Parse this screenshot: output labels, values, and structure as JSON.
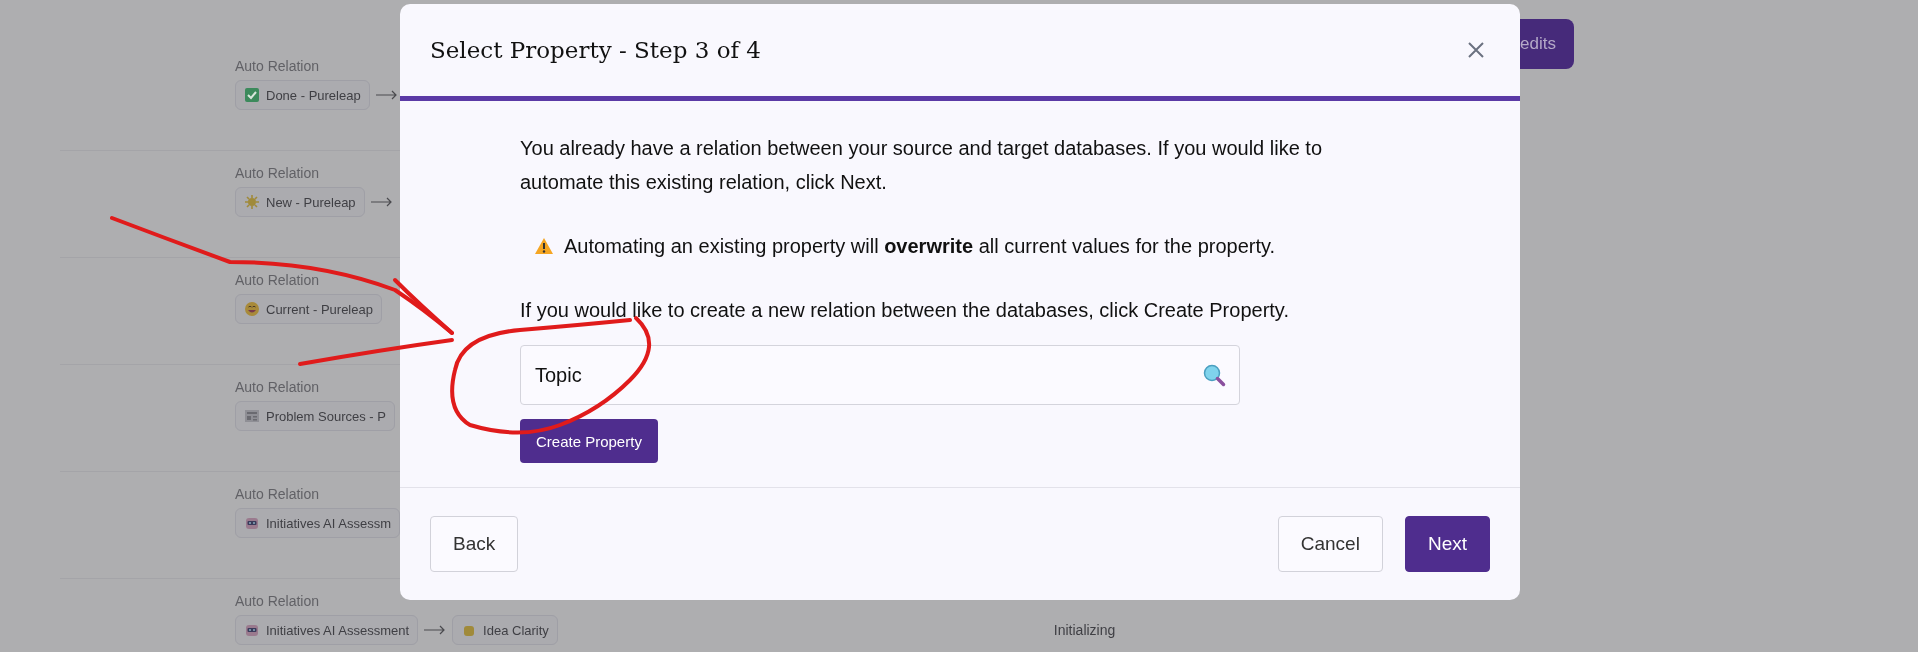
{
  "background": {
    "credits_button": "edits",
    "rows": [
      {
        "label": "Auto Relation",
        "kind": "check",
        "source": "Done - Pureleap",
        "arrow": true
      },
      {
        "label": "Auto Relation",
        "kind": "sun",
        "source": "New - Pureleap",
        "arrow": true
      },
      {
        "label": "Auto Relation",
        "kind": "smiley",
        "source": "Current - Pureleap",
        "arrow": false
      },
      {
        "label": "Auto Relation",
        "kind": "page",
        "source": "Problem Sources - P",
        "arrow": false
      },
      {
        "label": "Auto Relation",
        "kind": "robot",
        "source": "Initiatives AI Assessm",
        "arrow": false
      },
      {
        "label": "Auto Relation",
        "kind": "robot",
        "source": "Initiatives AI Assessment",
        "arrow": true,
        "target": "Idea Clarity",
        "status": "Initializing"
      }
    ]
  },
  "dialog": {
    "title": "Select Property - Step 3 of 4",
    "intro": "You already have a relation between your source and target databases. If you would like to automate this existing relation, click Next.",
    "warning": "Automating an existing property will **overwrite** all current values for the property.",
    "hint": "If you would like to create a new relation between the databases, click Create Property.",
    "search": {
      "value": "Topic"
    },
    "create_button": "Create Property",
    "buttons": [
      {
        "label": "Back",
        "kind": "secondary"
      },
      {
        "label": "Cancel",
        "kind": "secondary"
      },
      {
        "label": "Next",
        "kind": "primary"
      }
    ]
  }
}
